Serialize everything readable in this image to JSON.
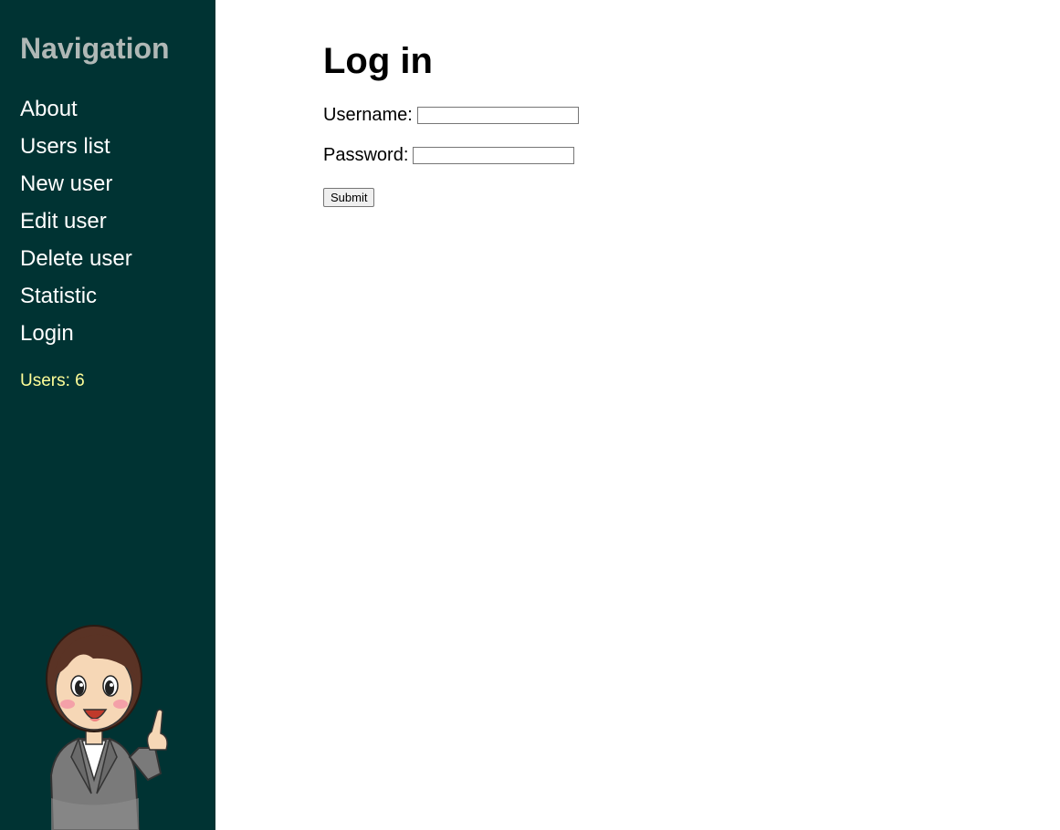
{
  "sidebar": {
    "title": "Navigation",
    "items": [
      {
        "label": "About"
      },
      {
        "label": "Users list"
      },
      {
        "label": "New user"
      },
      {
        "label": "Edit user"
      },
      {
        "label": "Delete user"
      },
      {
        "label": "Statistic"
      },
      {
        "label": "Login"
      }
    ],
    "user_count": "Users: 6",
    "illustration": "businesswoman-pointing-up"
  },
  "main": {
    "title": "Log in",
    "username_label": "Username:",
    "username_value": "",
    "password_label": "Password:",
    "password_value": "",
    "submit_label": "Submit"
  },
  "colors": {
    "sidebar_bg": "#003333",
    "nav_title": "#b0b8b6",
    "nav_link": "#ffffff",
    "user_count": "#ffff99"
  }
}
